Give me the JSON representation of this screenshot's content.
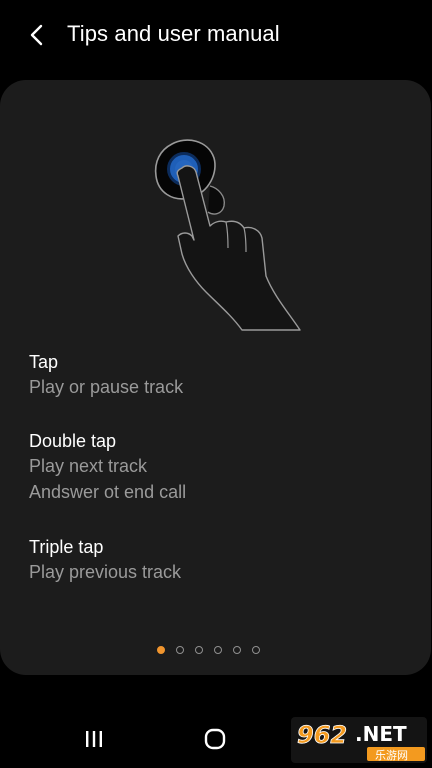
{
  "header": {
    "title": "Tips and user manual",
    "back_icon": "chevron-left-icon"
  },
  "tips": [
    {
      "title": "Tap",
      "lines": [
        "Play or pause track"
      ]
    },
    {
      "title": "Double tap",
      "lines": [
        "Play next track",
        "Andswer ot end call"
      ]
    },
    {
      "title": "Triple tap",
      "lines": [
        "Play previous track"
      ]
    }
  ],
  "pager": {
    "page_count": 6,
    "current_page": 1
  },
  "navbar": {
    "recents_icon": "recent-apps-icon",
    "home_icon": "home-icon"
  },
  "watermark": {
    "text": "962.NET",
    "subtext": "乐游网"
  },
  "colors": {
    "accent": "#f0952e",
    "card": "#1c1c1c",
    "background": "#000000",
    "secondary_text": "#9a9a9a",
    "earbud_blue": "#1f5fb8"
  }
}
